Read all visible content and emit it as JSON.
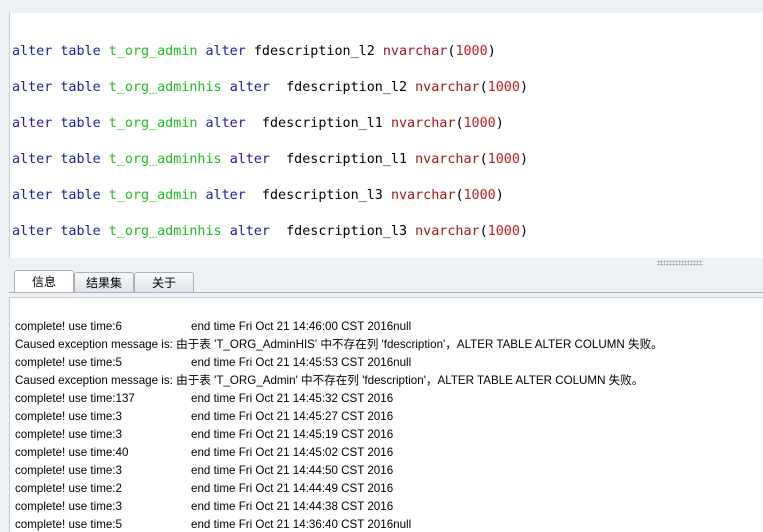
{
  "editor": {
    "lines": [
      {
        "kw1": "alter",
        "kw2": "table",
        "table": "t_org_admin",
        "kw3": "alter",
        "col": "fdescription_l2",
        "type": "nvarchar",
        "open": "(",
        "num": "1000",
        "close": ")"
      },
      {
        "kw1": "alter",
        "kw2": "table",
        "table": "t_org_adminhis",
        "kw3": "alter",
        "col": " fdescription_l2",
        "type": "nvarchar",
        "open": "(",
        "num": "1000",
        "close": ")"
      },
      {
        "kw1": "alter",
        "kw2": "table",
        "table": "t_org_admin",
        "kw3": "alter",
        "col": " fdescription_l1",
        "type": "nvarchar",
        "open": "(",
        "num": "1000",
        "close": ")"
      },
      {
        "kw1": "alter",
        "kw2": "table",
        "table": "t_org_adminhis",
        "kw3": "alter",
        "col": " fdescription_l1",
        "type": "nvarchar",
        "open": "(",
        "num": "1000",
        "close": ")"
      },
      {
        "kw1": "alter",
        "kw2": "table",
        "table": "t_org_admin",
        "kw3": "alter",
        "col": " fdescription_l3",
        "type": "nvarchar",
        "open": "(",
        "num": "1000",
        "close": ")"
      },
      {
        "kw1": "alter",
        "kw2": "table",
        "table": "t_org_adminhis",
        "kw3": "alter",
        "col": " fdescription_l3",
        "type": "nvarchar",
        "open": "(",
        "num": "1000",
        "close": ")"
      }
    ]
  },
  "tabs": [
    {
      "label": "信息"
    },
    {
      "label": "结果集"
    },
    {
      "label": "关于"
    }
  ],
  "log": [
    {
      "a": "complete! use time:6",
      "b": "end time Fri Oct 21 14:46:00 CST 2016null"
    },
    {
      "full": "Caused exception message is: 由于表 'T_ORG_AdminHIS' 中不存在列 'fdescription'，ALTER TABLE ALTER COLUMN 失败。"
    },
    {
      "a": "complete! use time:5",
      "b": "end time Fri Oct 21 14:45:53 CST 2016null"
    },
    {
      "full": "Caused exception message is: 由于表 'T_ORG_Admin' 中不存在列 'fdescription'，ALTER TABLE ALTER COLUMN 失败。"
    },
    {
      "a": "complete! use time:137",
      "b": "end time Fri Oct 21 14:45:32 CST 2016"
    },
    {
      "a": "complete! use time:3",
      "b": "end time Fri Oct 21 14:45:27 CST 2016"
    },
    {
      "a": "complete! use time:3",
      "b": "end time Fri Oct 21 14:45:19 CST 2016"
    },
    {
      "a": "complete! use time:40",
      "b": "end time Fri Oct 21 14:45:02 CST 2016"
    },
    {
      "a": "complete! use time:3",
      "b": "end time Fri Oct 21 14:44:50 CST 2016"
    },
    {
      "a": "complete! use time:2",
      "b": "end time Fri Oct 21 14:44:49 CST 2016"
    },
    {
      "a": "complete! use time:3",
      "b": "end time Fri Oct 21 14:44:38 CST 2016"
    },
    {
      "a": "complete! use time:5",
      "b": "end time Fri Oct 21 14:36:40 CST 2016null"
    }
  ],
  "colors": {
    "keyword": "#1a1aa6",
    "identifier": "#22bb22",
    "type": "#a31515",
    "number": "#c02020"
  }
}
